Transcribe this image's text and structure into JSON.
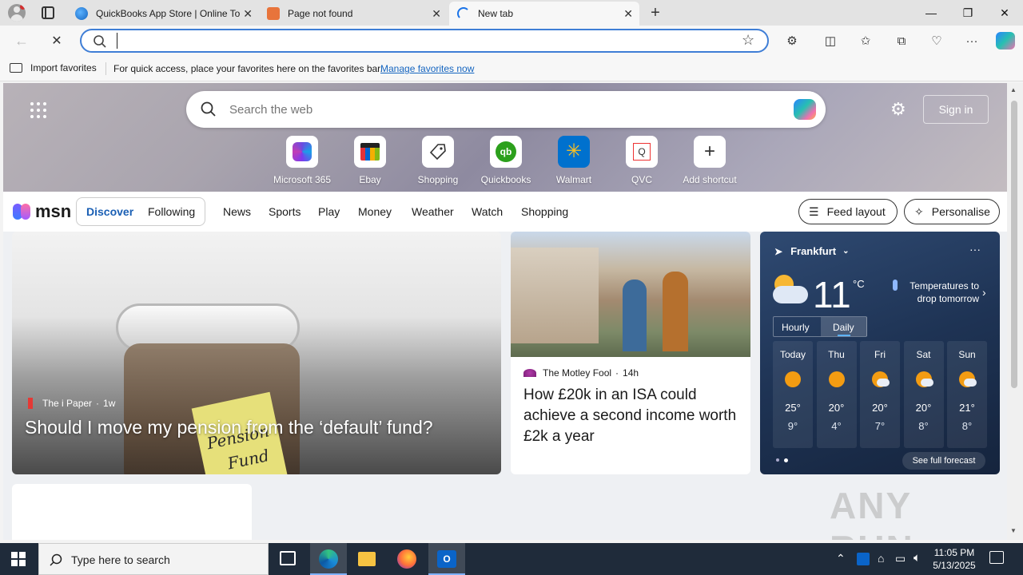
{
  "browser": {
    "tabs": [
      {
        "title": "QuickBooks App Store | Online To"
      },
      {
        "title": "Page not found"
      },
      {
        "title": "New tab"
      }
    ],
    "address_value": ""
  },
  "favorites_bar": {
    "import_label": "Import favorites",
    "message": "For quick access, place your favorites here on the favorites bar.",
    "manage_link": "Manage favorites now"
  },
  "page": {
    "search_placeholder": "Search the web",
    "sign_in_label": "Sign in",
    "shortcuts": [
      {
        "label": "Microsoft 365",
        "icon": "microsoft365-icon"
      },
      {
        "label": "Ebay",
        "icon": "ebay-icon"
      },
      {
        "label": "Shopping",
        "icon": "shopping-tag-icon"
      },
      {
        "label": "Quickbooks",
        "icon": "quickbooks-icon"
      },
      {
        "label": "Walmart",
        "icon": "walmart-icon"
      },
      {
        "label": "QVC",
        "icon": "qvc-icon"
      },
      {
        "label": "Add shortcut",
        "icon": "plus-icon"
      }
    ],
    "brand": "msn",
    "nav_tabs": [
      "Discover",
      "Following"
    ],
    "nav_links": [
      "News",
      "Sports",
      "Play",
      "Money",
      "Weather",
      "Watch",
      "Shopping"
    ],
    "feed_layout_label": "Feed layout",
    "personalise_label": "Personalise",
    "main_story": {
      "source": "The i Paper",
      "age": "1w",
      "headline": "Should I move my pension from the ‘default’ fund?",
      "jar_label_line1": "Pension",
      "jar_label_line2": "Fund"
    },
    "second_story": {
      "source": "The Motley Fool",
      "age": "14h",
      "headline": "How £20k in an ISA could achieve a second income worth £2k a year"
    },
    "weather": {
      "location": "Frankfurt",
      "temp": "11",
      "unit": "°C",
      "alert_line1": "Temperatures to",
      "alert_line2": "drop tomorrow",
      "tabs": [
        "Hourly",
        "Daily"
      ],
      "days": [
        {
          "day": "Today",
          "high": "25°",
          "low": "9°",
          "icon": "sun-icon"
        },
        {
          "day": "Thu",
          "high": "20°",
          "low": "4°",
          "icon": "sun-icon"
        },
        {
          "day": "Fri",
          "high": "20°",
          "low": "7°",
          "icon": "partly-cloudy-icon"
        },
        {
          "day": "Sat",
          "high": "20°",
          "low": "8°",
          "icon": "partly-cloudy-icon"
        },
        {
          "day": "Sun",
          "high": "21°",
          "low": "8°",
          "icon": "sun-cloud-icon"
        }
      ],
      "forecast_link": "See full forecast"
    }
  },
  "taskbar": {
    "search_placeholder": "Type here to search",
    "time": "11:05 PM",
    "date": "5/13/2025"
  },
  "watermark": "ANY RUN"
}
